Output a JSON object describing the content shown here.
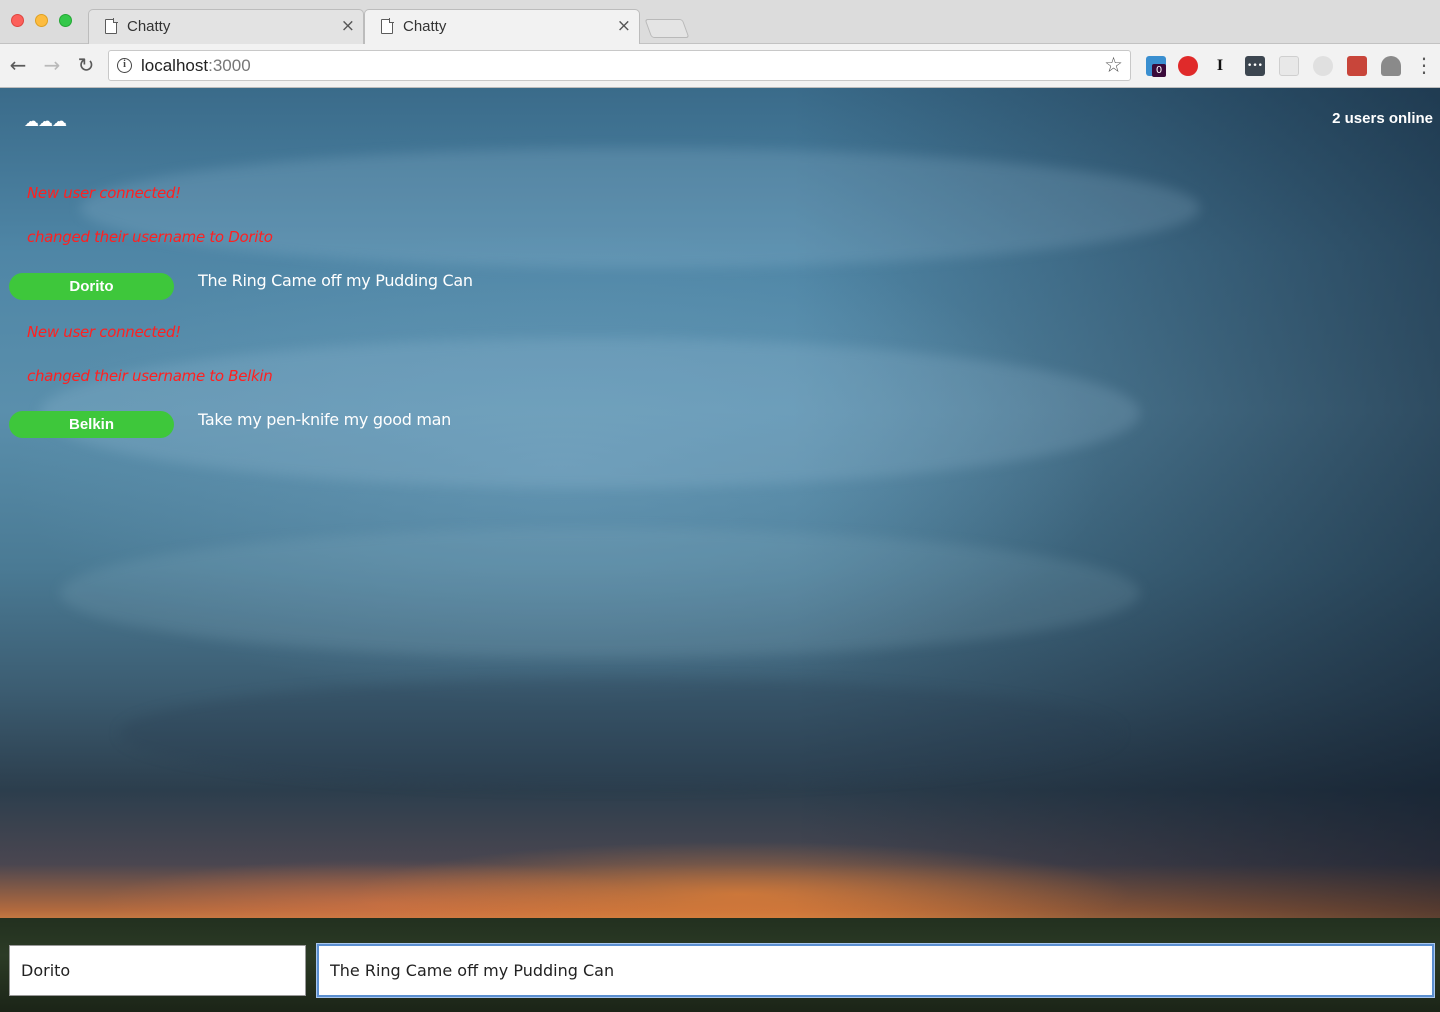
{
  "browser": {
    "tabs": [
      {
        "title": "Chatty",
        "close": "×",
        "icon": "document-icon"
      },
      {
        "title": "Chatty",
        "close": "×",
        "icon": "document-icon"
      }
    ],
    "url_host": "localhost",
    "url_port": ":3000",
    "extensions": [
      {
        "name": "ghostery-icon",
        "badge": "0",
        "color": "#3a8fd0"
      },
      {
        "name": "opera-vpn-icon",
        "color": "#e02a2a"
      },
      {
        "name": "instapaper-icon",
        "glyph": "I",
        "color": "#ffffff"
      },
      {
        "name": "lastpass-icon",
        "glyph": "•••",
        "color": "#3c4650"
      },
      {
        "name": "reader-icon",
        "color": "#d6d6d6"
      },
      {
        "name": "sync-icon",
        "color": "#d6d6d6"
      },
      {
        "name": "puzzle-extension-icon",
        "color": "#c8453a"
      },
      {
        "name": "profile-icon",
        "color": "#888888"
      }
    ],
    "menu_glyph": "⋮"
  },
  "app": {
    "logo": "☁☁☁",
    "users_online": "2 users online",
    "messages": [
      {
        "type": "system",
        "text": "New user connected!"
      },
      {
        "type": "system",
        "text": "changed their username to Dorito"
      },
      {
        "type": "message",
        "username": "Dorito",
        "content": "The Ring Came off my Pudding Can"
      },
      {
        "type": "system",
        "text": "New user connected!"
      },
      {
        "type": "system",
        "text": "changed their username to Belkin"
      },
      {
        "type": "message",
        "username": "Belkin",
        "content": "Take my pen-knife my good man"
      }
    ],
    "chatbar": {
      "username_value": "Dorito",
      "message_value": "The Ring Came off my Pudding Can"
    },
    "colors": {
      "system_text": "#ff2020",
      "username_badge": "#3ec73b"
    }
  }
}
